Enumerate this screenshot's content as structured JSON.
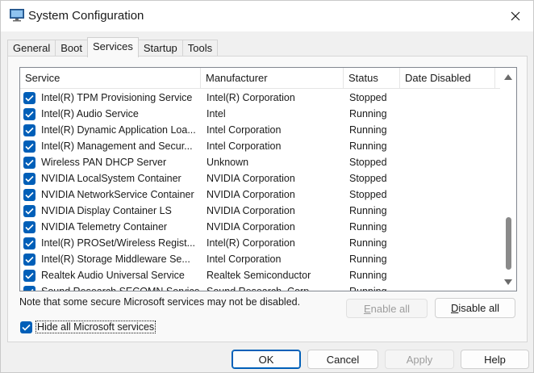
{
  "window": {
    "title": "System Configuration",
    "accent": "#005fb8"
  },
  "tabs": [
    {
      "label": "General",
      "active": false
    },
    {
      "label": "Boot",
      "active": false
    },
    {
      "label": "Services",
      "active": true
    },
    {
      "label": "Startup",
      "active": false
    },
    {
      "label": "Tools",
      "active": false
    }
  ],
  "table": {
    "columns": [
      "Service",
      "Manufacturer",
      "Status",
      "Date Disabled"
    ],
    "rows": [
      {
        "checked": true,
        "service": "Intel(R) TPM Provisioning Service",
        "manufacturer": "Intel(R) Corporation",
        "status": "Stopped",
        "date_disabled": ""
      },
      {
        "checked": true,
        "service": "Intel(R) Audio Service",
        "manufacturer": "Intel",
        "status": "Running",
        "date_disabled": ""
      },
      {
        "checked": true,
        "service": "Intel(R) Dynamic Application Loa...",
        "manufacturer": "Intel Corporation",
        "status": "Running",
        "date_disabled": ""
      },
      {
        "checked": true,
        "service": "Intel(R) Management and Secur...",
        "manufacturer": "Intel Corporation",
        "status": "Running",
        "date_disabled": ""
      },
      {
        "checked": true,
        "service": "Wireless PAN DHCP Server",
        "manufacturer": "Unknown",
        "status": "Stopped",
        "date_disabled": ""
      },
      {
        "checked": true,
        "service": "NVIDIA LocalSystem Container",
        "manufacturer": "NVIDIA Corporation",
        "status": "Stopped",
        "date_disabled": ""
      },
      {
        "checked": true,
        "service": "NVIDIA NetworkService Container",
        "manufacturer": "NVIDIA Corporation",
        "status": "Stopped",
        "date_disabled": ""
      },
      {
        "checked": true,
        "service": "NVIDIA Display Container LS",
        "manufacturer": "NVIDIA Corporation",
        "status": "Running",
        "date_disabled": ""
      },
      {
        "checked": true,
        "service": "NVIDIA Telemetry Container",
        "manufacturer": "NVIDIA Corporation",
        "status": "Running",
        "date_disabled": ""
      },
      {
        "checked": true,
        "service": "Intel(R) PROSet/Wireless Regist...",
        "manufacturer": "Intel(R) Corporation",
        "status": "Running",
        "date_disabled": ""
      },
      {
        "checked": true,
        "service": "Intel(R) Storage Middleware Se...",
        "manufacturer": "Intel Corporation",
        "status": "Running",
        "date_disabled": ""
      },
      {
        "checked": true,
        "service": "Realtek Audio Universal Service",
        "manufacturer": "Realtek Semiconductor",
        "status": "Running",
        "date_disabled": ""
      },
      {
        "checked": true,
        "service": "Sound Research SECOMN Service",
        "manufacturer": "Sound Research, Corp.",
        "status": "Running",
        "date_disabled": ""
      }
    ],
    "scroll": {
      "thumb_start": 0.78,
      "thumb_end": 1.0
    }
  },
  "note": "Note that some secure Microsoft services may not be disabled.",
  "enable_all": {
    "label": "Enable all",
    "enabled": false
  },
  "disable_all": {
    "label": "Disable all",
    "enabled": true
  },
  "hide_ms": {
    "label": "Hide all Microsoft services",
    "checked": true
  },
  "footer": {
    "ok": "OK",
    "cancel": "Cancel",
    "apply": "Apply",
    "help": "Help"
  }
}
